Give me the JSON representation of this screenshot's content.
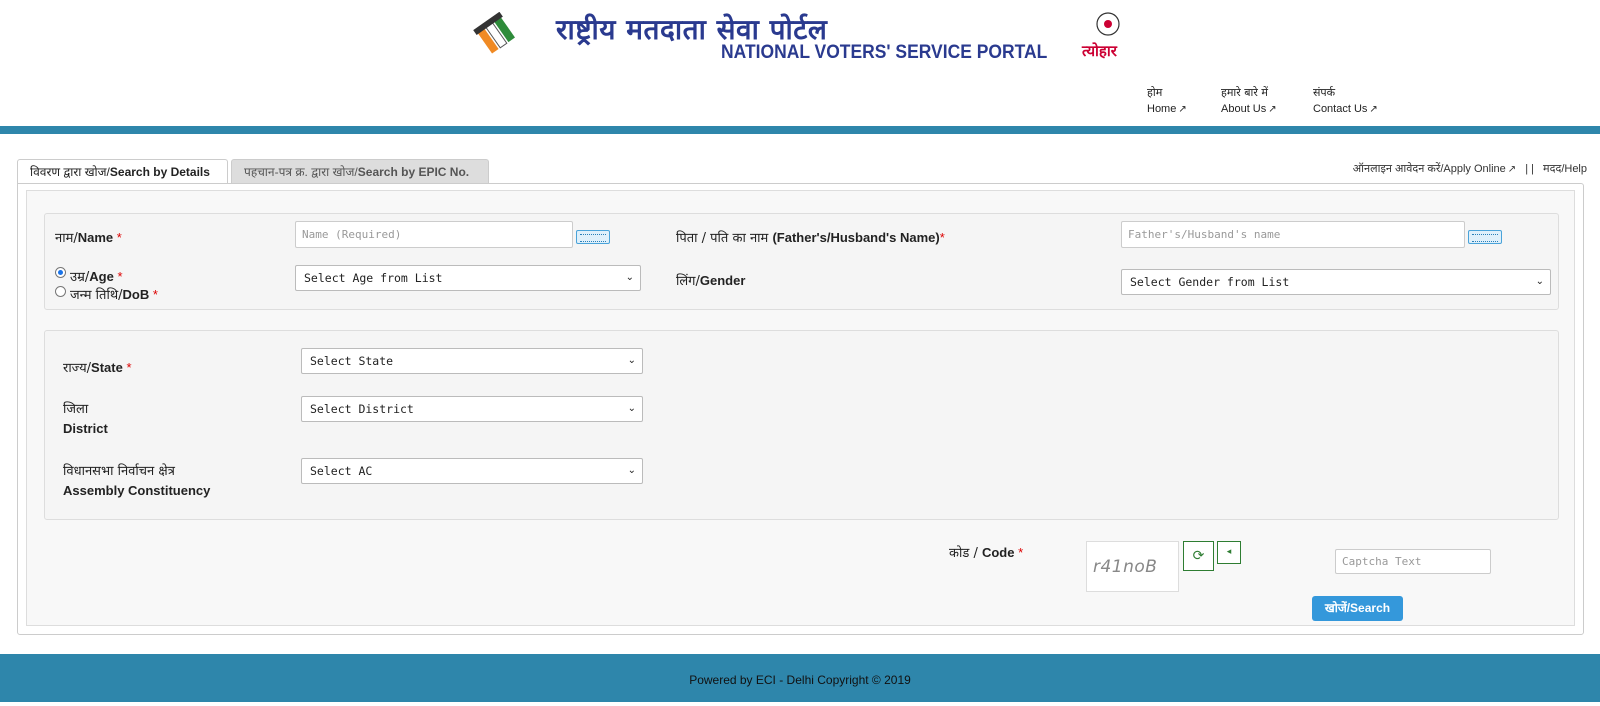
{
  "header": {
    "title_hindi": "राष्ट्रीय मतदाता सेवा पोर्टल",
    "title_english": "NATIONAL VOTERS' SERVICE PORTAL",
    "logo_right_text": "त्योहार",
    "nav": [
      {
        "hi": "होम",
        "en": "Home"
      },
      {
        "hi": "हमारे बारे में",
        "en": "About Us"
      },
      {
        "hi": "संपर्क",
        "en": "Contact Us"
      }
    ]
  },
  "tabs": [
    {
      "hi": "विवरण द्वारा खोज/",
      "en": "Search by Details",
      "active": true
    },
    {
      "hi": "पहचान-पत्र क्र. द्वारा खोज/",
      "en": "Search by EPIC No.",
      "active": false
    }
  ],
  "help_links": {
    "apply_hi": "ऑनलाइन आवेदन करें/",
    "apply_en": "Apply Online",
    "help_hi": "मदद",
    "help_en": "/Help",
    "separator": "|  |"
  },
  "form": {
    "name": {
      "hi": "नाम/",
      "en": "Name",
      "placeholder": "Name (Required)"
    },
    "father": {
      "hi": "पिता / पति का नाम ",
      "en": "(Father's/Husband's Name)",
      "placeholder": "Father's/Husband's name"
    },
    "age": {
      "hi": "उम्र/",
      "en": "Age",
      "selected": true
    },
    "dob": {
      "hi": "जन्म तिथि/",
      "en": "DoB",
      "selected": false
    },
    "age_select": "Select Age from List",
    "gender": {
      "hi": "लिंग/",
      "en": "Gender",
      "select": "Select Gender from List"
    },
    "state": {
      "hi": "राज्य/",
      "en": "State",
      "select": "Select State"
    },
    "district": {
      "hi": "जिला",
      "en": "District",
      "select": "Select District"
    },
    "ac": {
      "hi": "विधानसभा निर्वाचन क्षेत्र",
      "en": "Assembly Constituency",
      "select": "Select AC"
    },
    "code": {
      "hi": "कोड / ",
      "en": "Code"
    },
    "captcha_image_text": "r41noB",
    "captcha_placeholder": "Captcha Text",
    "search_button": "खोजें/Search"
  },
  "required_mark": "*",
  "footer": {
    "text": "Powered by ECI - Delhi Copyright © 2019"
  },
  "colors": {
    "brand_blue": "#2e86ab",
    "title_navy": "#2a3a8f",
    "button_blue": "#3498db",
    "required_red": "#dd0000"
  }
}
